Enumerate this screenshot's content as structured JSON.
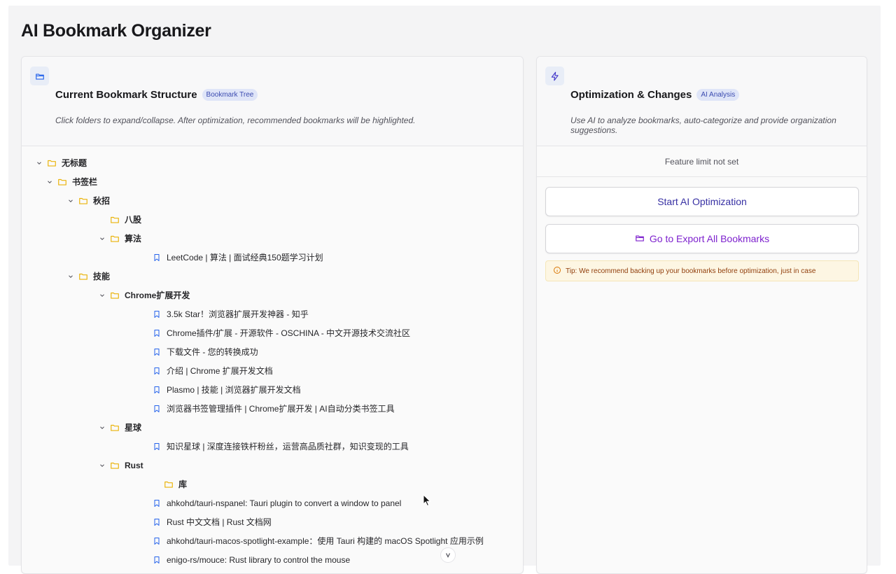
{
  "page": {
    "title": "AI Bookmark Organizer"
  },
  "left_card": {
    "title": "Current Bookmark Structure",
    "badge": "Bookmark Tree",
    "description": "Click folders to expand/collapse. After optimization, recommended bookmarks will be highlighted.",
    "icon": "folder-open-icon"
  },
  "right_card": {
    "title": "Optimization & Changes",
    "badge": "AI Analysis",
    "description": "Use AI to analyze bookmarks, auto-categorize and provide organization suggestions.",
    "icon": "lightning-icon",
    "feature_limit": "Feature limit not set",
    "start_button": "Start AI Optimization",
    "export_button": "Go to Export All Bookmarks",
    "tip": "Tip: We recommend backing up your bookmarks before optimization, just in case"
  },
  "tree": [
    {
      "type": "folder",
      "label": "无标题",
      "expanded": true
    },
    {
      "type": "folder",
      "label": "书签栏",
      "expanded": true
    },
    {
      "type": "folder",
      "label": "秋招",
      "expanded": true
    },
    {
      "type": "folder",
      "label": "八股",
      "expanded": false
    },
    {
      "type": "folder",
      "label": "算法",
      "expanded": true
    },
    {
      "type": "bookmark",
      "label": "LeetCode | 算法 | 面试经典150题学习计划"
    },
    {
      "type": "folder",
      "label": "技能",
      "expanded": true
    },
    {
      "type": "folder",
      "label": "Chrome扩展开发",
      "expanded": true
    },
    {
      "type": "bookmark",
      "label": "3.5k Star！浏览器扩展开发神器 - 知乎"
    },
    {
      "type": "bookmark",
      "label": "Chrome插件/扩展 - 开源软件 - OSCHINA - 中文开源技术交流社区"
    },
    {
      "type": "bookmark",
      "label": "下载文件 - 您的转换成功"
    },
    {
      "type": "bookmark",
      "label": "介绍 | Chrome 扩展开发文档"
    },
    {
      "type": "bookmark",
      "label": "Plasmo | 技能 | 浏览器扩展开发文档"
    },
    {
      "type": "bookmark",
      "label": "浏览器书签管理插件 | Chrome扩展开发 | AI自动分类书签工具"
    },
    {
      "type": "folder",
      "label": "星球",
      "expanded": true
    },
    {
      "type": "bookmark",
      "label": "知识星球 | 深度连接铁杆粉丝，运营高品质社群，知识变现的工具"
    },
    {
      "type": "folder",
      "label": "Rust",
      "expanded": true
    },
    {
      "type": "folder",
      "label": "库",
      "expanded": false
    },
    {
      "type": "bookmark",
      "label": "ahkohd/tauri-nspanel: Tauri plugin to convert a window to panel"
    },
    {
      "type": "bookmark",
      "label": "Rust 中文文档 | Rust 文档网"
    },
    {
      "type": "bookmark",
      "label": "ahkohd/tauri-macos-spotlight-example：使用 Tauri 构建的 macOS Spotlight 应用示例"
    },
    {
      "type": "bookmark",
      "label": "enigo-rs/mouce: Rust library to control the mouse"
    }
  ],
  "colors": {
    "folder": "#eab308",
    "bookmark": "#2563eb",
    "start_text": "#3730a3",
    "export_text": "#7e22ce",
    "tip_text": "#92400e"
  }
}
